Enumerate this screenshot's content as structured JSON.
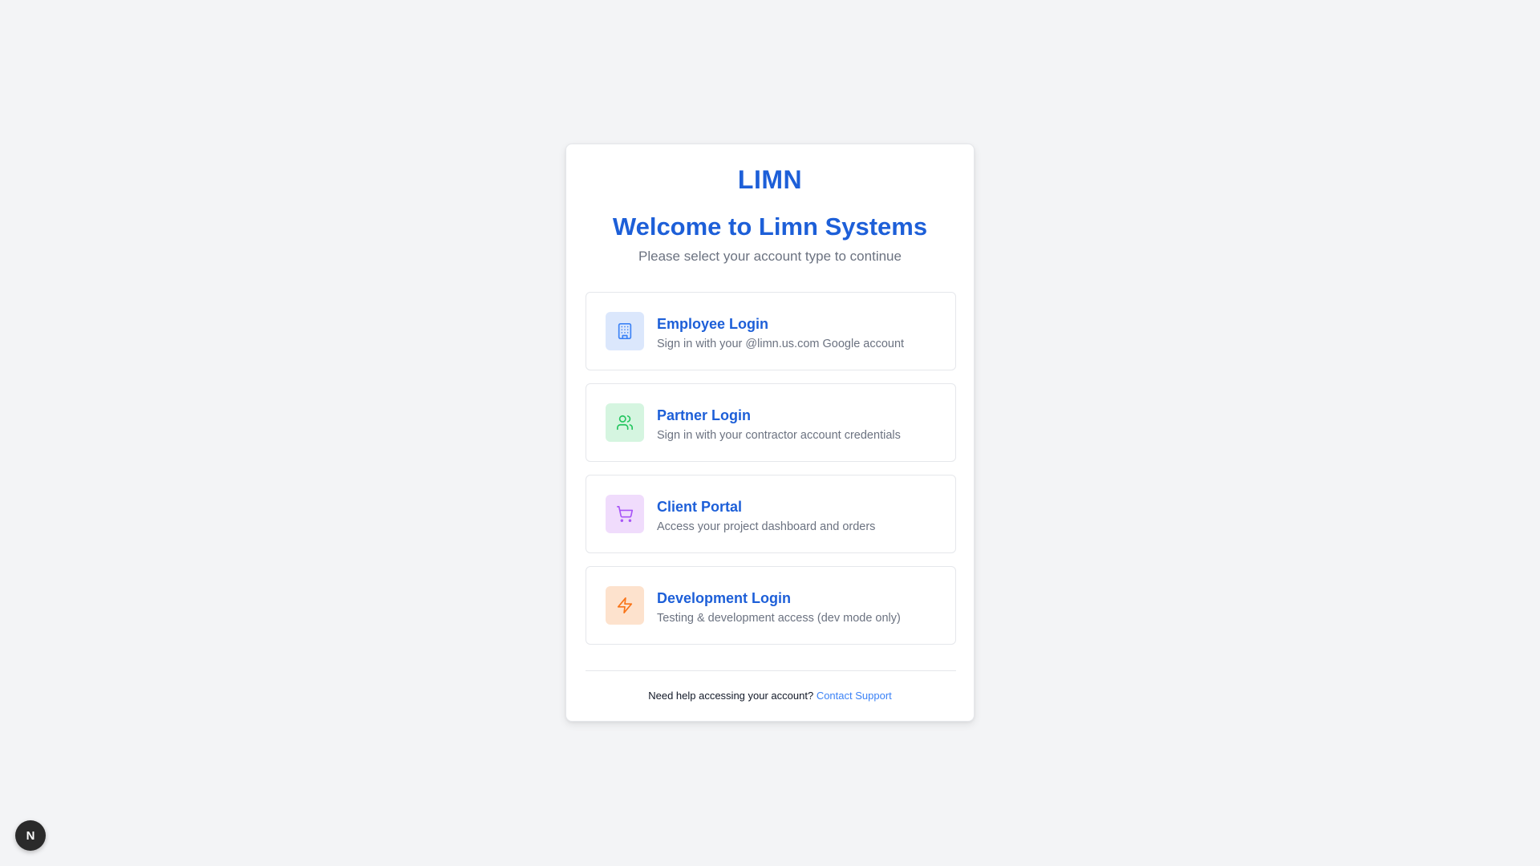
{
  "brand": {
    "logo": "LIMN",
    "accent_color": "#1d5fd8"
  },
  "header": {
    "title": "Welcome to Limn Systems",
    "subtitle": "Please select your account type to continue"
  },
  "options": [
    {
      "title": "Employee Login",
      "description": "Sign in with your @limn.us.com Google account",
      "icon": "building-icon",
      "icon_bg": "#dbe7fc",
      "icon_color": "#3b82f6"
    },
    {
      "title": "Partner Login",
      "description": "Sign in with your contractor account credentials",
      "icon": "users-icon",
      "icon_bg": "#d5f5e0",
      "icon_color": "#22c55e"
    },
    {
      "title": "Client Portal",
      "description": "Access your project dashboard and orders",
      "icon": "shopping-cart-icon",
      "icon_bg": "#f0dcfc",
      "icon_color": "#a855f7"
    },
    {
      "title": "Development Login",
      "description": "Testing & development access (dev mode only)",
      "icon": "lightning-icon",
      "icon_bg": "#fde2cd",
      "icon_color": "#f97316"
    }
  ],
  "footer": {
    "help_text": "Need help accessing your account?",
    "support_link": "Contact Support"
  },
  "dev_badge": {
    "letter": "N"
  }
}
